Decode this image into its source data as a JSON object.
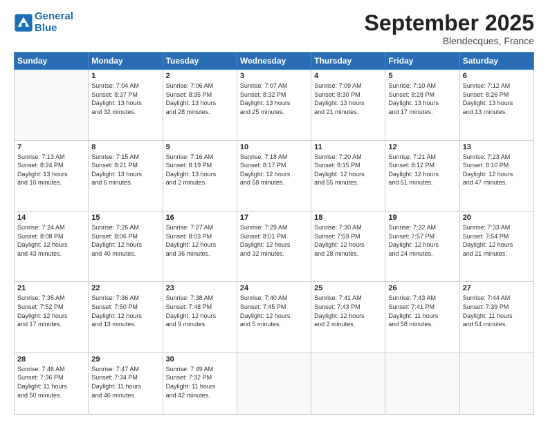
{
  "header": {
    "logo_line1": "General",
    "logo_line2": "Blue",
    "month": "September 2025",
    "location": "Blendecques, France"
  },
  "weekdays": [
    "Sunday",
    "Monday",
    "Tuesday",
    "Wednesday",
    "Thursday",
    "Friday",
    "Saturday"
  ],
  "weeks": [
    [
      {
        "day": "",
        "info": ""
      },
      {
        "day": "1",
        "info": "Sunrise: 7:04 AM\nSunset: 8:37 PM\nDaylight: 13 hours\nand 32 minutes."
      },
      {
        "day": "2",
        "info": "Sunrise: 7:06 AM\nSunset: 8:35 PM\nDaylight: 13 hours\nand 28 minutes."
      },
      {
        "day": "3",
        "info": "Sunrise: 7:07 AM\nSunset: 8:32 PM\nDaylight: 13 hours\nand 25 minutes."
      },
      {
        "day": "4",
        "info": "Sunrise: 7:09 AM\nSunset: 8:30 PM\nDaylight: 13 hours\nand 21 minutes."
      },
      {
        "day": "5",
        "info": "Sunrise: 7:10 AM\nSunset: 8:28 PM\nDaylight: 13 hours\nand 17 minutes."
      },
      {
        "day": "6",
        "info": "Sunrise: 7:12 AM\nSunset: 8:26 PM\nDaylight: 13 hours\nand 13 minutes."
      }
    ],
    [
      {
        "day": "7",
        "info": "Sunrise: 7:13 AM\nSunset: 8:24 PM\nDaylight: 13 hours\nand 10 minutes."
      },
      {
        "day": "8",
        "info": "Sunrise: 7:15 AM\nSunset: 8:21 PM\nDaylight: 13 hours\nand 6 minutes."
      },
      {
        "day": "9",
        "info": "Sunrise: 7:16 AM\nSunset: 8:19 PM\nDaylight: 13 hours\nand 2 minutes."
      },
      {
        "day": "10",
        "info": "Sunrise: 7:18 AM\nSunset: 8:17 PM\nDaylight: 12 hours\nand 58 minutes."
      },
      {
        "day": "11",
        "info": "Sunrise: 7:20 AM\nSunset: 8:15 PM\nDaylight: 12 hours\nand 55 minutes."
      },
      {
        "day": "12",
        "info": "Sunrise: 7:21 AM\nSunset: 8:12 PM\nDaylight: 12 hours\nand 51 minutes."
      },
      {
        "day": "13",
        "info": "Sunrise: 7:23 AM\nSunset: 8:10 PM\nDaylight: 12 hours\nand 47 minutes."
      }
    ],
    [
      {
        "day": "14",
        "info": "Sunrise: 7:24 AM\nSunset: 8:08 PM\nDaylight: 12 hours\nand 43 minutes."
      },
      {
        "day": "15",
        "info": "Sunrise: 7:26 AM\nSunset: 8:06 PM\nDaylight: 12 hours\nand 40 minutes."
      },
      {
        "day": "16",
        "info": "Sunrise: 7:27 AM\nSunset: 8:03 PM\nDaylight: 12 hours\nand 36 minutes."
      },
      {
        "day": "17",
        "info": "Sunrise: 7:29 AM\nSunset: 8:01 PM\nDaylight: 12 hours\nand 32 minutes."
      },
      {
        "day": "18",
        "info": "Sunrise: 7:30 AM\nSunset: 7:59 PM\nDaylight: 12 hours\nand 28 minutes."
      },
      {
        "day": "19",
        "info": "Sunrise: 7:32 AM\nSunset: 7:57 PM\nDaylight: 12 hours\nand 24 minutes."
      },
      {
        "day": "20",
        "info": "Sunrise: 7:33 AM\nSunset: 7:54 PM\nDaylight: 12 hours\nand 21 minutes."
      }
    ],
    [
      {
        "day": "21",
        "info": "Sunrise: 7:35 AM\nSunset: 7:52 PM\nDaylight: 12 hours\nand 17 minutes."
      },
      {
        "day": "22",
        "info": "Sunrise: 7:36 AM\nSunset: 7:50 PM\nDaylight: 12 hours\nand 13 minutes."
      },
      {
        "day": "23",
        "info": "Sunrise: 7:38 AM\nSunset: 7:48 PM\nDaylight: 12 hours\nand 9 minutes."
      },
      {
        "day": "24",
        "info": "Sunrise: 7:40 AM\nSunset: 7:45 PM\nDaylight: 12 hours\nand 5 minutes."
      },
      {
        "day": "25",
        "info": "Sunrise: 7:41 AM\nSunset: 7:43 PM\nDaylight: 12 hours\nand 2 minutes."
      },
      {
        "day": "26",
        "info": "Sunrise: 7:43 AM\nSunset: 7:41 PM\nDaylight: 11 hours\nand 58 minutes."
      },
      {
        "day": "27",
        "info": "Sunrise: 7:44 AM\nSunset: 7:39 PM\nDaylight: 11 hours\nand 54 minutes."
      }
    ],
    [
      {
        "day": "28",
        "info": "Sunrise: 7:46 AM\nSunset: 7:36 PM\nDaylight: 11 hours\nand 50 minutes."
      },
      {
        "day": "29",
        "info": "Sunrise: 7:47 AM\nSunset: 7:34 PM\nDaylight: 11 hours\nand 46 minutes."
      },
      {
        "day": "30",
        "info": "Sunrise: 7:49 AM\nSunset: 7:32 PM\nDaylight: 11 hours\nand 42 minutes."
      },
      {
        "day": "",
        "info": ""
      },
      {
        "day": "",
        "info": ""
      },
      {
        "day": "",
        "info": ""
      },
      {
        "day": "",
        "info": ""
      }
    ]
  ]
}
